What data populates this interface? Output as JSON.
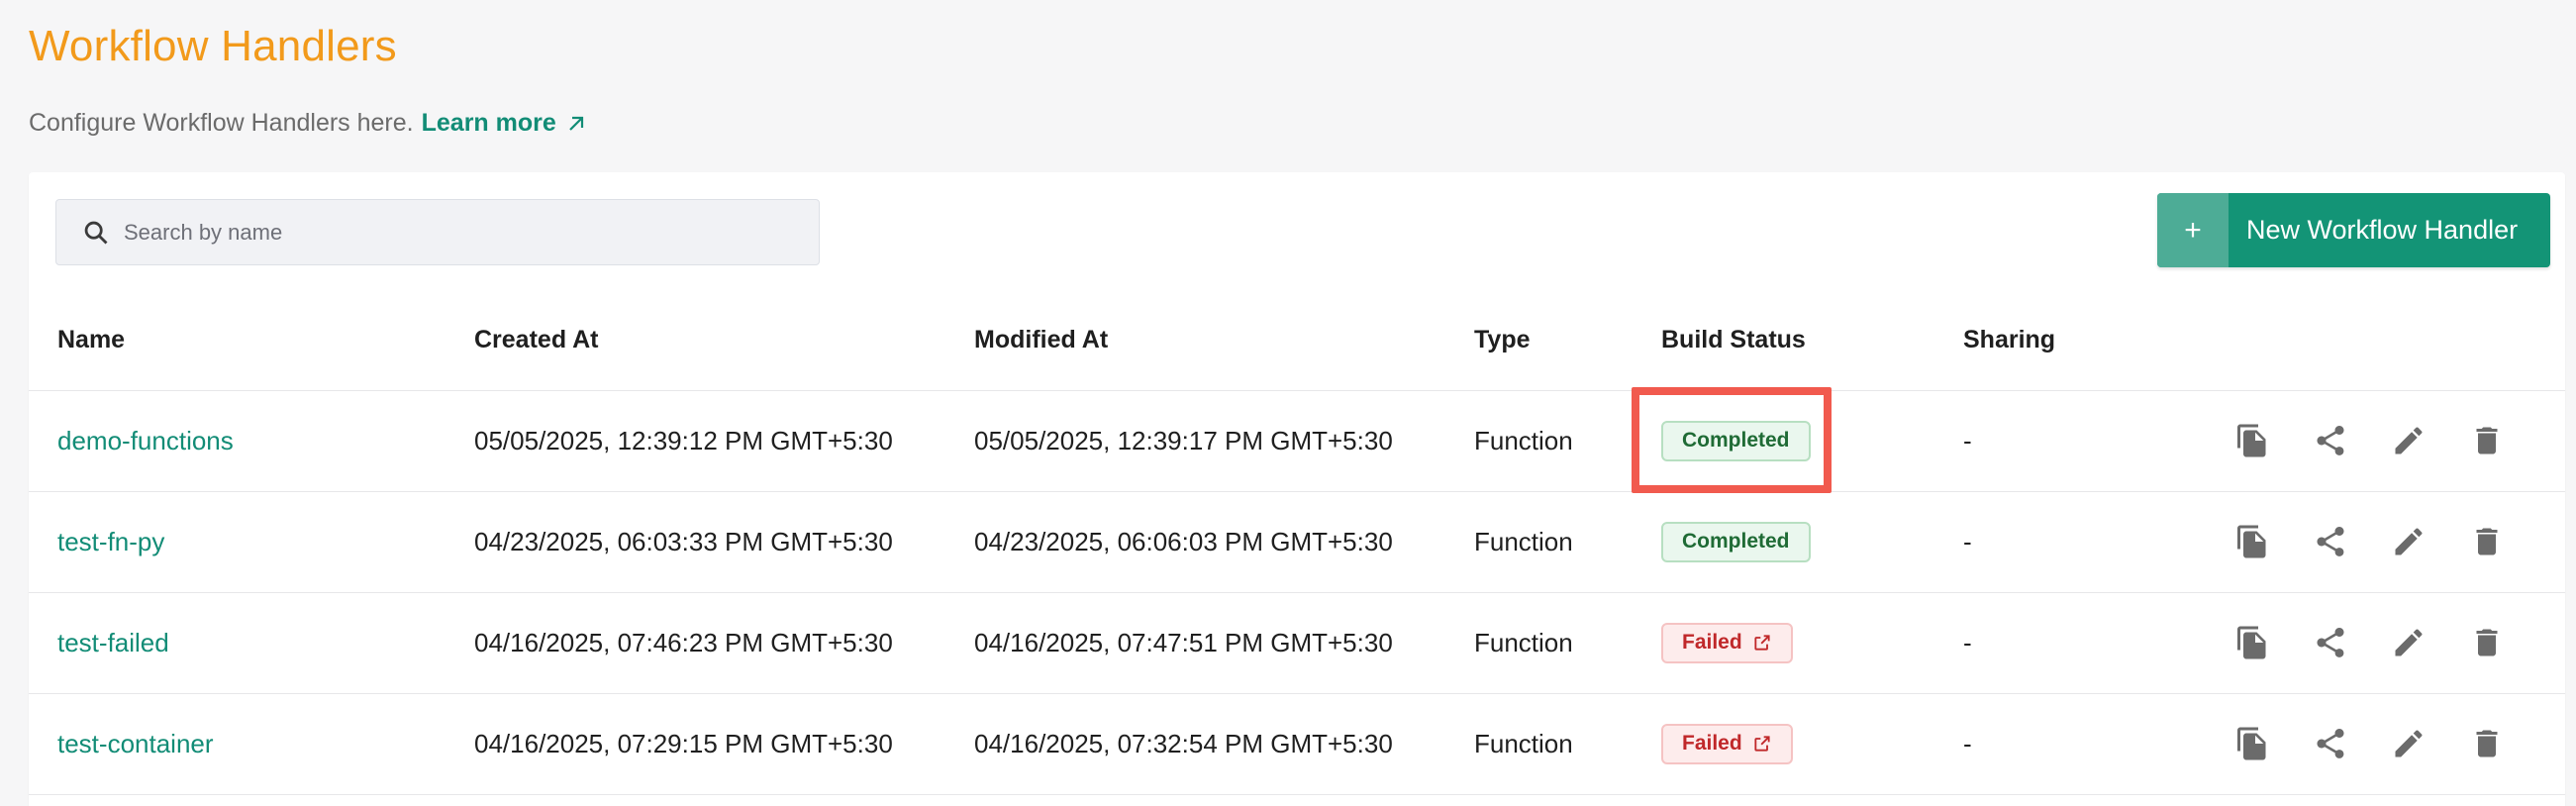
{
  "header": {
    "title": "Workflow Handlers",
    "subtitle": "Configure Workflow Handlers here.",
    "learn_more": "Learn more"
  },
  "search": {
    "placeholder": "Search by name",
    "value": ""
  },
  "new_button": {
    "icon": "+",
    "label": "New Workflow Handler"
  },
  "columns": {
    "name": "Name",
    "created": "Created At",
    "modified": "Modified At",
    "type": "Type",
    "status": "Build Status",
    "sharing": "Sharing"
  },
  "rows": [
    {
      "name": "demo-functions",
      "created": "05/05/2025, 12:39:12 PM GMT+5:30",
      "modified": "05/05/2025, 12:39:17 PM GMT+5:30",
      "type": "Function",
      "status": "Completed",
      "sharing": "-"
    },
    {
      "name": "test-fn-py",
      "created": "04/23/2025, 06:03:33 PM GMT+5:30",
      "modified": "04/23/2025, 06:06:03 PM GMT+5:30",
      "type": "Function",
      "status": "Completed",
      "sharing": "-"
    },
    {
      "name": "test-failed",
      "created": "04/16/2025, 07:46:23 PM GMT+5:30",
      "modified": "04/16/2025, 07:47:51 PM GMT+5:30",
      "type": "Function",
      "status": "Failed",
      "sharing": "-"
    },
    {
      "name": "test-container",
      "created": "04/16/2025, 07:29:15 PM GMT+5:30",
      "modified": "04/16/2025, 07:32:54 PM GMT+5:30",
      "type": "Function",
      "status": "Failed",
      "sharing": "-"
    }
  ],
  "colors": {
    "title": "#f29a1b",
    "accent": "#139476",
    "link": "#128c76",
    "highlight": "#f15a4e"
  },
  "icons": {
    "search": "search-icon",
    "external": "arrow-up-right-icon",
    "copy": "copy-icon",
    "share": "share-icon",
    "edit": "pencil-icon",
    "delete": "trash-icon"
  }
}
